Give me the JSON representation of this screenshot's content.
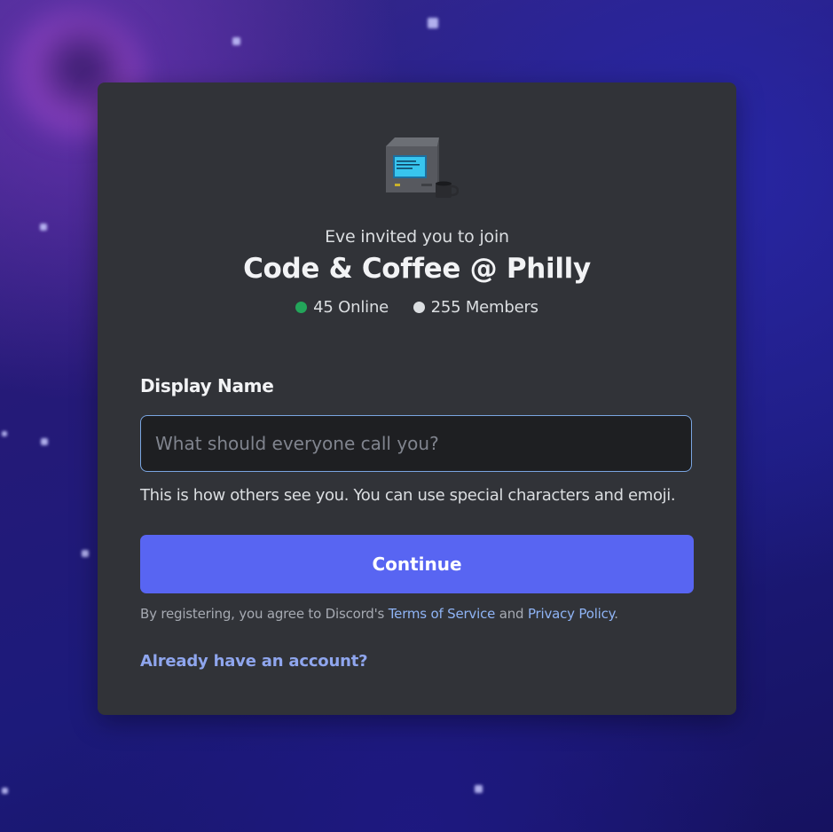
{
  "invite": {
    "inviter": "Eve",
    "invite_text": "invited you to join",
    "server_name": "Code & Coffee @ Philly",
    "online_count": "45 Online",
    "member_count": "255 Members"
  },
  "form": {
    "display_name_label": "Display Name",
    "display_name_placeholder": "What should everyone call you?",
    "display_name_value": "",
    "helper_text": "This is how others see you. You can use special characters and emoji.",
    "continue_label": "Continue"
  },
  "legal": {
    "prefix": "By registering, you agree to Discord's",
    "terms_label": "Terms of Service",
    "conjunction": "and",
    "privacy_label": "Privacy Policy",
    "suffix": "."
  },
  "login": {
    "link_label": "Already have an account?"
  },
  "icons": {
    "server": "computer-coffee-icon",
    "online_status": "online-dot-icon",
    "member_status": "member-dot-icon"
  },
  "colors": {
    "card_bg": "#313338",
    "accent": "#5865f2",
    "online": "#23a55a",
    "link": "#8fb4f5",
    "input_border": "#7aa5e0"
  }
}
